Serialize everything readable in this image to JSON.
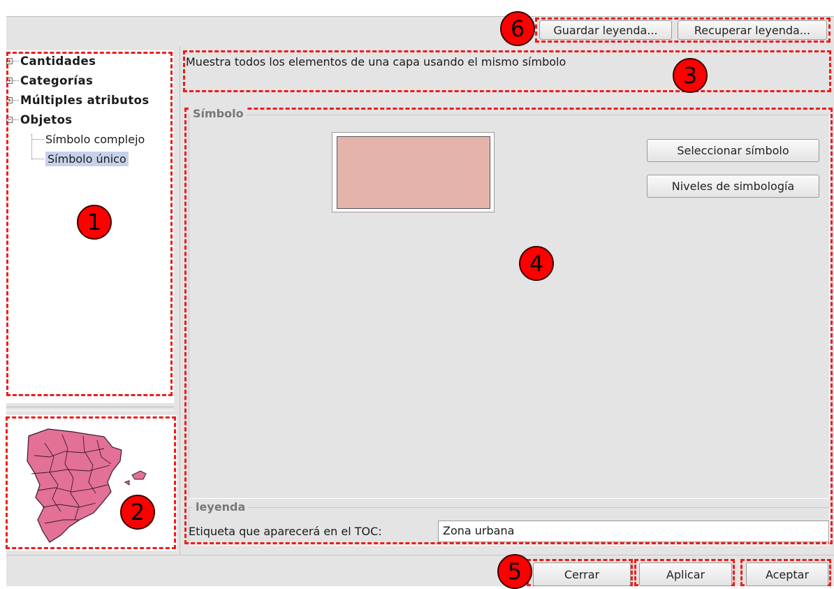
{
  "toolbar": {
    "save_legend_label": "Guardar leyenda...",
    "load_legend_label": "Recuperar leyenda..."
  },
  "tree": {
    "items": [
      {
        "label": "Cantidades",
        "expander": "+"
      },
      {
        "label": "Categorías",
        "expander": "+"
      },
      {
        "label": "Múltiples atributos",
        "expander": "+"
      },
      {
        "label": "Objetos",
        "expander": "−"
      }
    ],
    "children": [
      {
        "label": "Símbolo complejo"
      },
      {
        "label": "Símbolo único",
        "selected": true
      }
    ]
  },
  "description": "Muestra todos los elementos de una capa usando el mismo símbolo",
  "symbol_group": {
    "title": "Símbolo",
    "swatch_color": "#e4b4aa",
    "select_symbol_label": "Seleccionar símbolo",
    "symbology_levels_label": "Niveles de simbología"
  },
  "legend_group": {
    "title": "leyenda",
    "label_text": "Etiqueta que aparecerá en el TOC:",
    "label_value": "Zona urbana"
  },
  "footer": {
    "close_label": "Cerrar",
    "apply_label": "Aplicar",
    "accept_label": "Aceptar"
  },
  "markers": [
    "1",
    "2",
    "3",
    "4",
    "5",
    "6"
  ],
  "colors": {
    "annotation_dash": "#ee1c1c",
    "marker_fill": "#ff0000",
    "map_fill": "#e27195",
    "selection": "#c5d3ea"
  }
}
